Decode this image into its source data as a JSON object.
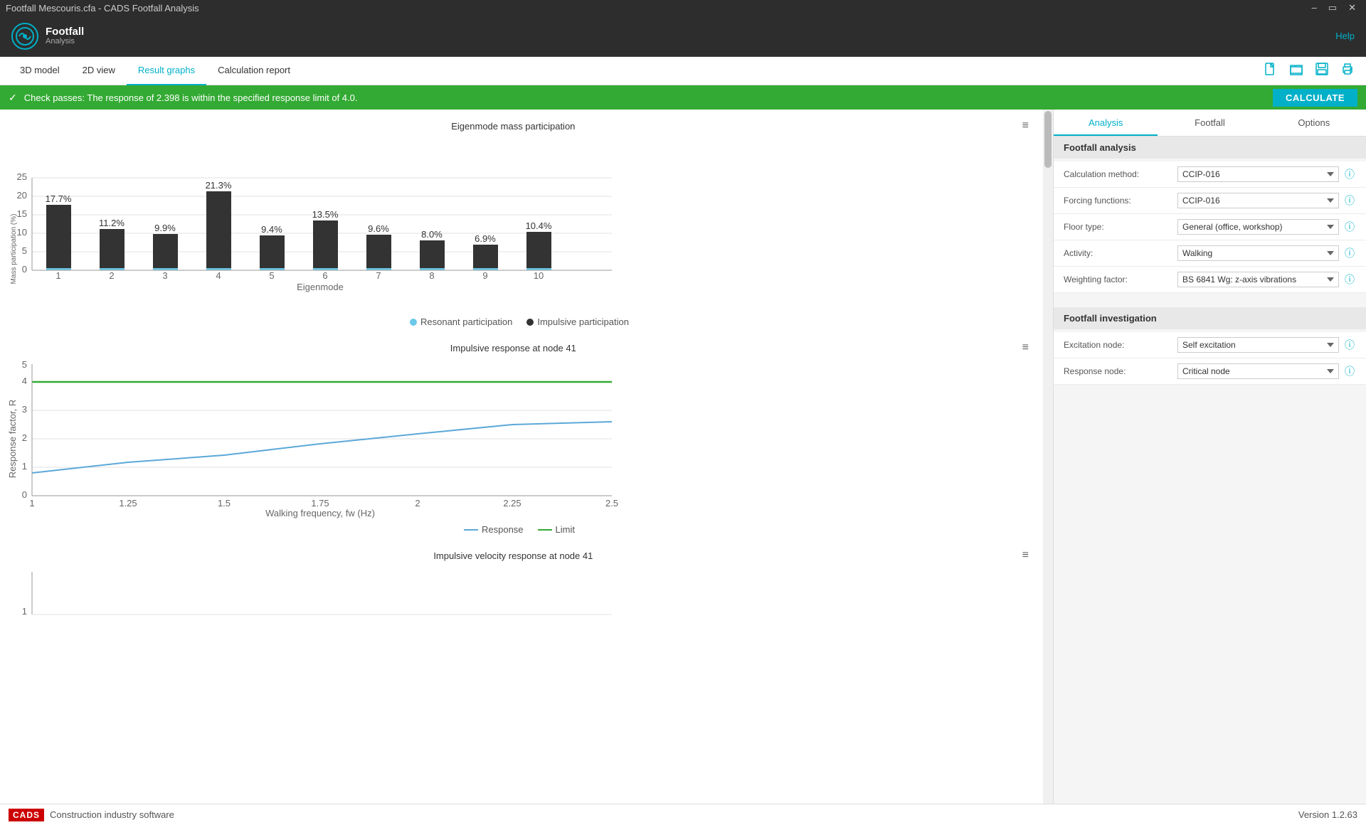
{
  "titleBar": {
    "title": "Footfall Mescouris.cfa - CADS Footfall Analysis",
    "controls": [
      "minimize",
      "maximize",
      "close"
    ]
  },
  "appHeader": {
    "logoLine1": "Footfall",
    "logoLine2": "Analysis",
    "helpLabel": "Help"
  },
  "toolbar": {
    "tabs": [
      {
        "id": "3d-model",
        "label": "3D model",
        "active": false
      },
      {
        "id": "2d-view",
        "label": "2D view",
        "active": false
      },
      {
        "id": "result-graphs",
        "label": "Result graphs",
        "active": true
      },
      {
        "id": "calc-report",
        "label": "Calculation report",
        "active": false
      }
    ],
    "icons": [
      "new",
      "open",
      "save",
      "print"
    ]
  },
  "statusBar": {
    "message": "Check passes: The response of 2.398 is within the specified response limit of 4.0.",
    "calcButton": "CALCULATE"
  },
  "charts": {
    "chart1": {
      "title": "Eigenmode mass participation",
      "xLabel": "Eigenmode",
      "yLabel": "Mass participation (%)",
      "bars": [
        {
          "x": 1,
          "impulsive": 17.7,
          "resonant": 2.1
        },
        {
          "x": 2,
          "impulsive": 11.2,
          "resonant": 1.5
        },
        {
          "x": 3,
          "impulsive": 9.9,
          "resonant": 1.2
        },
        {
          "x": 4,
          "impulsive": 21.3,
          "resonant": 2.5
        },
        {
          "x": 5,
          "impulsive": 9.4,
          "resonant": 1.1
        },
        {
          "x": 6,
          "impulsive": 13.5,
          "resonant": 1.6
        },
        {
          "x": 7,
          "impulsive": 9.6,
          "resonant": 1.0
        },
        {
          "x": 8,
          "impulsive": 8.0,
          "resonant": 0.9
        },
        {
          "x": 9,
          "impulsive": 6.9,
          "resonant": 0.8
        },
        {
          "x": 10,
          "impulsive": 10.4,
          "resonant": 1.2
        }
      ],
      "legend": {
        "resonant": "Resonant participation",
        "impulsive": "Impulsive participation"
      }
    },
    "chart2": {
      "title": "Impulsive response at node 41",
      "xLabel": "Walking frequency, fw (Hz)",
      "yLabel": "Response factor, R",
      "legend": {
        "response": "Response",
        "limit": "Limit"
      }
    },
    "chart3": {
      "title": "Impulsive velocity response at node 41"
    }
  },
  "rightPanel": {
    "tabs": [
      {
        "id": "analysis",
        "label": "Analysis",
        "active": true
      },
      {
        "id": "footfall",
        "label": "Footfall",
        "active": false
      },
      {
        "id": "options",
        "label": "Options",
        "active": false
      }
    ],
    "footfallAnalysis": {
      "sectionTitle": "Footfall analysis",
      "fields": [
        {
          "id": "calc-method",
          "label": "Calculation method:",
          "value": "CCIP-016"
        },
        {
          "id": "forcing-functions",
          "label": "Forcing functions:",
          "value": "CCIP-016"
        },
        {
          "id": "floor-type",
          "label": "Floor type:",
          "value": "General (office, workshop)"
        },
        {
          "id": "activity",
          "label": "Activity:",
          "value": "Walking"
        },
        {
          "id": "weighting-factor",
          "label": "Weighting factor:",
          "value": "BS 6841 Wg: z-axis vibrations"
        }
      ]
    },
    "footfallInvestigation": {
      "sectionTitle": "Footfall investigation",
      "fields": [
        {
          "id": "excitation-node",
          "label": "Excitation node:",
          "value": "Self excitation"
        },
        {
          "id": "response-node",
          "label": "Response node:",
          "value": "Critical node"
        }
      ]
    }
  },
  "footer": {
    "cadsLabel": "CADS",
    "footerText": "Construction industry software",
    "version": "Version 1.2.63"
  }
}
